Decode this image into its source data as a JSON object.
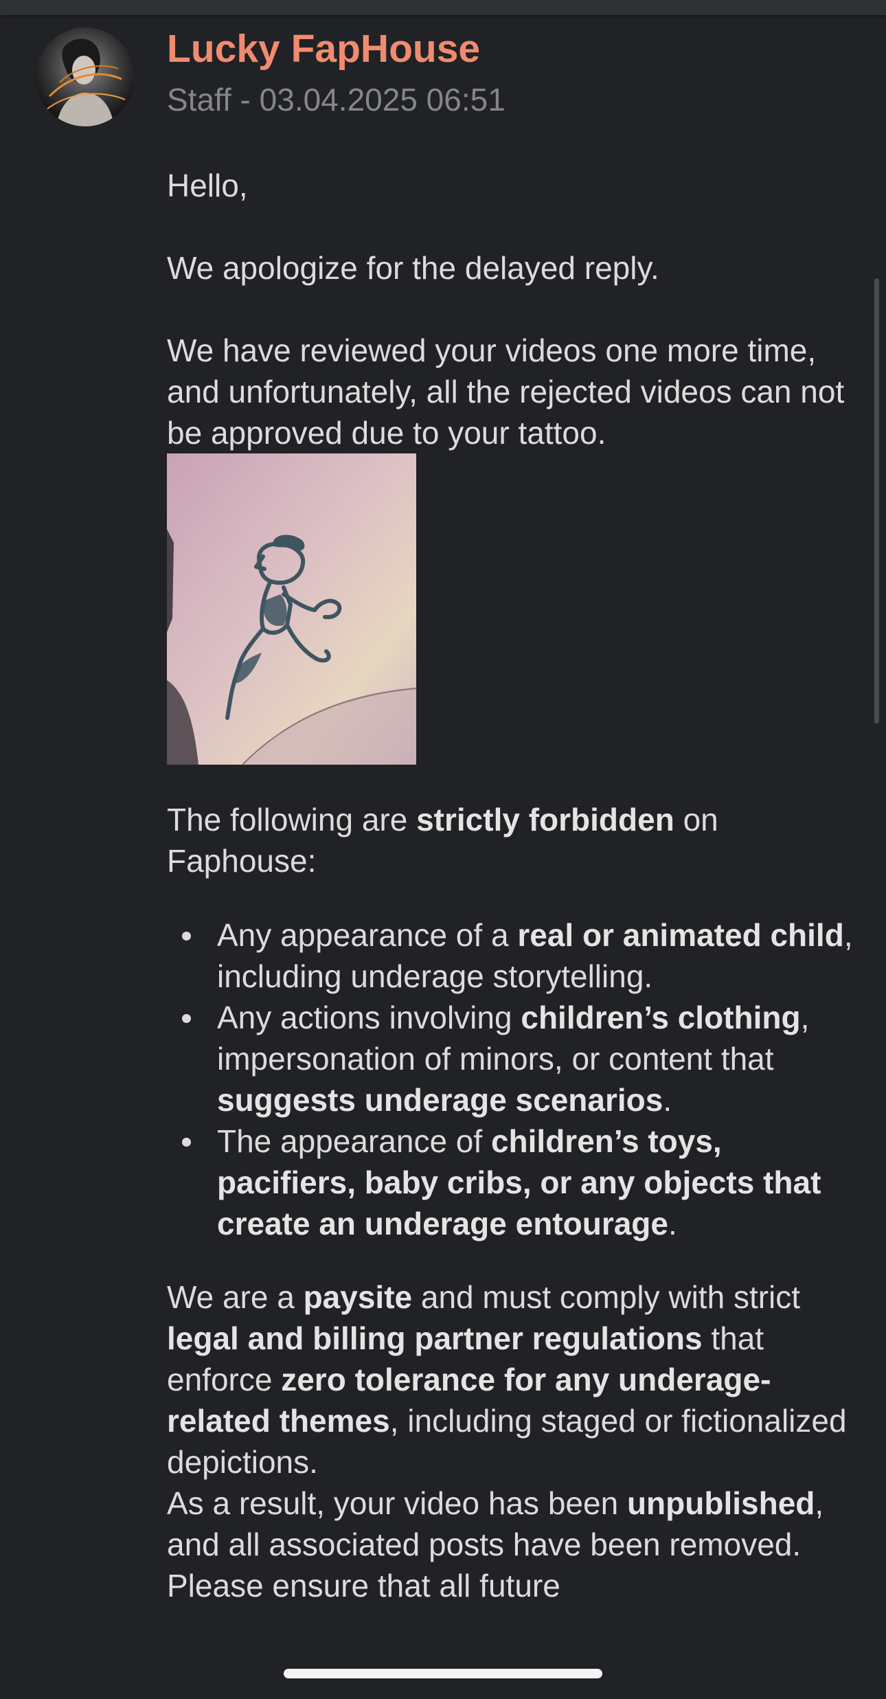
{
  "post": {
    "author": "Lucky FapHouse",
    "role": "Staff",
    "separator": " - ",
    "datetime": "03.04.2025 06:51"
  },
  "message": {
    "greeting": "Hello,",
    "apology": "We apologize for the delayed reply.",
    "review": "We have reviewed your videos one more time, and unfortunately, all the rejected videos can not be approved due to your tattoo.",
    "forbidden_intro": {
      "pre": "The following are ",
      "strong": "strictly forbidden",
      "post": " on Faphouse:"
    },
    "rules": [
      {
        "t1": "Any appearance of a ",
        "b1": "real or animated child",
        "t2": ", including underage storytelling."
      },
      {
        "t1": "Any actions involving ",
        "b1": "children’s clothing",
        "t2": ", impersonation of minors, or content that ",
        "b2": "suggests underage scenarios",
        "t3": "."
      },
      {
        "t1": "The appearance of ",
        "b1": "children’s toys, pacifiers, baby cribs, or any objects that create an underage entourage",
        "t2": "."
      }
    ],
    "compliance": {
      "t1": "We are a ",
      "b1": "paysite",
      "t2": " and must comply with strict ",
      "b2": "legal and billing partner regulations",
      "t3": " that enforce ",
      "b3": "zero tolerance for any underage-related themes",
      "t4": ", including staged or fictionalized depictions."
    },
    "result": {
      "t1": "As a result, your video has been ",
      "b1": "unpublished",
      "t2": ", and all associated posts have been removed. Please ensure that all future"
    }
  },
  "icons": {
    "avatar": "avatar-image",
    "bullet": "bullet-icon"
  },
  "colors": {
    "background": "#212225",
    "author": "#f08b70",
    "meta": "#85868a",
    "text": "#dcdcdc"
  }
}
